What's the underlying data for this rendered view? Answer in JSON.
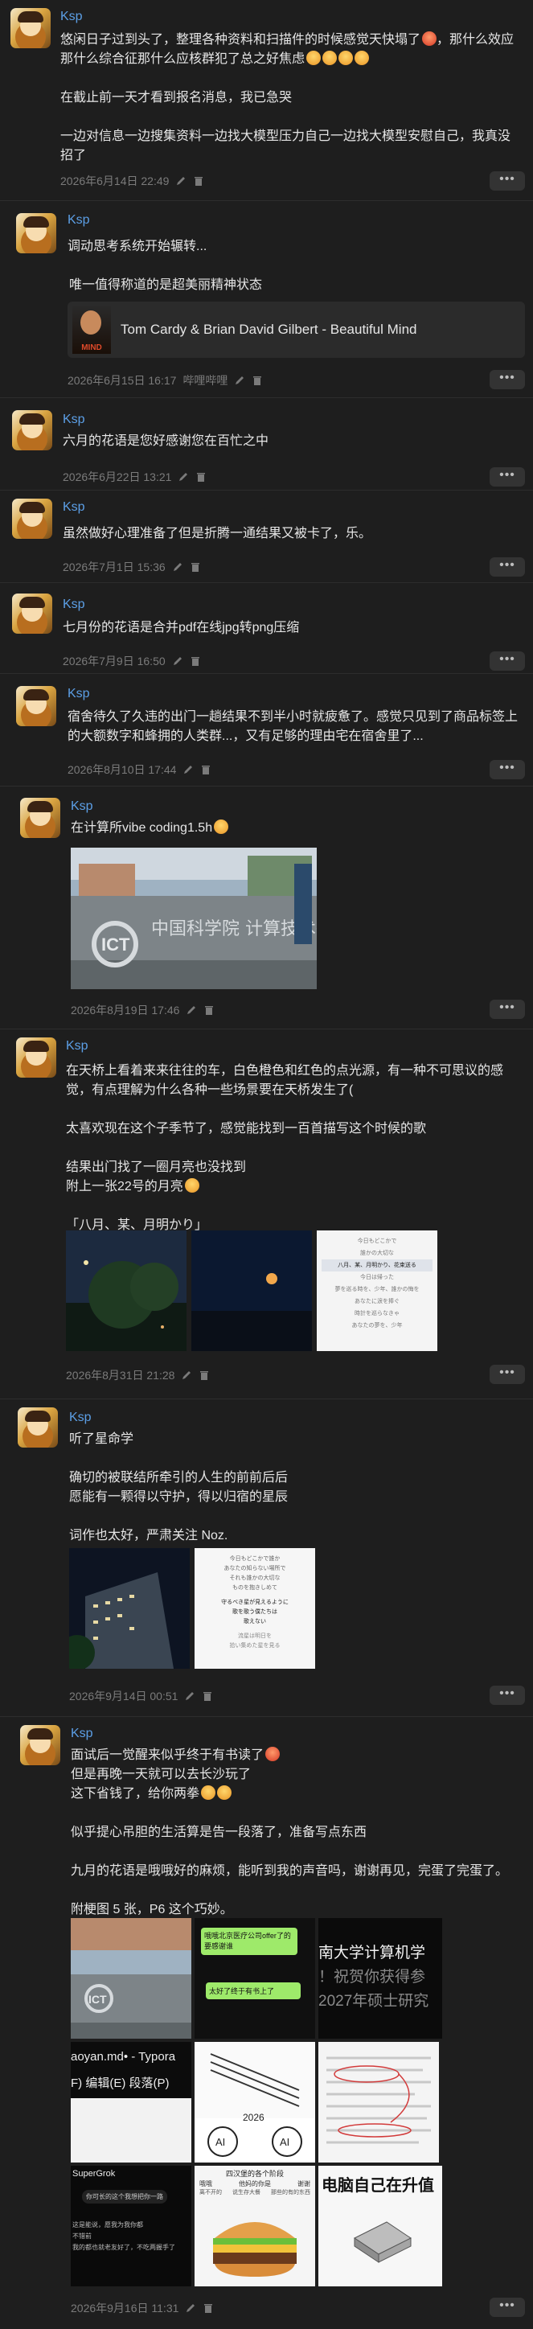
{
  "posts": [
    {
      "author": "Ksp",
      "lines": [
        "悠闲日子过到头了，整理各种资料和扫描件的时候感觉天快塌了",
        "那什么综合征那什么应核群犯了总之好焦虑",
        "",
        "在截止前一天才看到报名消息，我已急哭",
        "",
        "一边对信息一边搜集资料一边找大模型压力自己一边找大模型安慰自己，我真没",
        "招了"
      ],
      "timestamp": "2026年6月14日 22:49"
    },
    {
      "author": "Ksp",
      "lines": [
        "调动思考系统开始辗转...",
        "",
        "唯一值得称道的是超美丽精神状态"
      ],
      "music": {
        "title": "Tom Cardy & Brian David Gilbert - Beautiful Mind",
        "cover_text": "MIND"
      },
      "timestamp": "2026年6月15日 16:17",
      "source": "哔哩哔哩"
    },
    {
      "author": "Ksp",
      "lines": [
        "六月的花语是您好感谢您在百忙之中"
      ],
      "timestamp": "2026年6月22日 13:21"
    },
    {
      "author": "Ksp",
      "lines": [
        "虽然做好心理准备了但是折腾一通结果又被卡了，乐。"
      ],
      "timestamp": "2026年7月1日 15:36"
    },
    {
      "author": "Ksp",
      "lines": [
        "七月份的花语是合并pdf在线jpg转png压缩"
      ],
      "timestamp": "2026年7月9日 16:50"
    },
    {
      "author": "Ksp",
      "lines": [
        "宿舍待久了久违的出门一趟结果不到半小时就疲惫了。感觉只见到了商品标签上",
        "的大额数字和蜂拥的人类群...，又有足够的理由宅在宿舍里了..."
      ],
      "timestamp": "2026年8月10日 17:44"
    },
    {
      "author": "Ksp",
      "lines": [
        "在计算所vibe coding1.5h"
      ],
      "timestamp": "2026年8月19日 17:46",
      "sign_text": "中国科学院 计算技术研究所"
    },
    {
      "author": "Ksp",
      "lines": [
        "在天桥上看着来来往往的车，白色橙色和红色的点光源，有一种不可思议的感",
        "觉，有点理解为什么各种一些场景要在天桥发生了(",
        "",
        "太喜欢现在这个子季节了，感觉能找到一百首描写这个时候的歌",
        "",
        "结果出门找了一圈月亮也没找到",
        "附上一张22号的月亮",
        "",
        "「八月、某、月明かり」"
      ],
      "lyric_lines": [
        "今日もどこかで",
        "誰かの大切な",
        "八月、某、月明かり、花束送る",
        "今日は帰った",
        "夢を巡る時を、少年、誰かの悔を",
        "あなたに涙を捧ぐ",
        "時計を巡らなきゃ",
        "あなたの夢を、少年"
      ],
      "timestamp": "2026年8月31日 21:28"
    },
    {
      "author": "Ksp",
      "lines": [
        "听了星命学",
        "",
        "确切的被联结所牵引的人生的前前后后",
        "愿能有一颗得以守护，得以归宿的星辰",
        "",
        "词作也太好，严肃关注 Noz."
      ],
      "phone_lines": [
        "今日もどこかで誰か",
        "あなたの知らない場所で",
        "それも誰かの大切な",
        "ものを抱きしめて",
        "",
        "守るべき星が見えるように",
        "歌を歌う僕たちは",
        "歌えない",
        "",
        "流星は明日を",
        "拾い集めた星を見る"
      ],
      "timestamp": "2026年9月14日 00:51"
    },
    {
      "author": "Ksp",
      "lines": [
        "面试后一觉醒来似乎终于有书读了",
        "但是再晚一天就可以去长沙玩了",
        "这下省钱了，给你两拳",
        "",
        "似乎提心吊胆的生活算是告一段落了，准备写点东西",
        "",
        "九月的花语是哦哦好的麻烦，能听到我的声音吗，谢谢再见，完蛋了完蛋了。",
        "",
        "附梗图 5 张，P6 这个巧妙。"
      ],
      "grid": {
        "chat_bubble_1": "哦哦北京医疗公司offer了的要感谢谁",
        "chat_bubble_2": "太好了终于有书上了",
        "school_line_1": "南大学计算机学",
        "school_line_2": "！祝贺你获得参",
        "school_line_3": "2027年硕士研究",
        "typora_title": "aoyan.md• - Typora",
        "typora_menu": "F)   编辑(E)   段落(P)",
        "ai_year": "2026",
        "ai_label": "AI",
        "grok_title": "SuperGrok",
        "grok_lines": [
          "你可长的这个我想把你一路",
          "这是能说，愿我为我你都",
          "不错前",
          "我的都也就老友好了，不吃两握手了"
        ],
        "burger_header": "四汉堡的各个阶段",
        "burger_labels": [
          "哦哦",
          "他妈的你是",
          "谢谢"
        ],
        "burger_labels_2": [
          "离不开的",
          "说生存大餐",
          "那些的有的东西"
        ],
        "computer_text": "电脑自己在升值"
      },
      "timestamp": "2026年9月16日 11:31"
    }
  ],
  "more_label": "•••",
  "music_source": "哔哩哔哩"
}
